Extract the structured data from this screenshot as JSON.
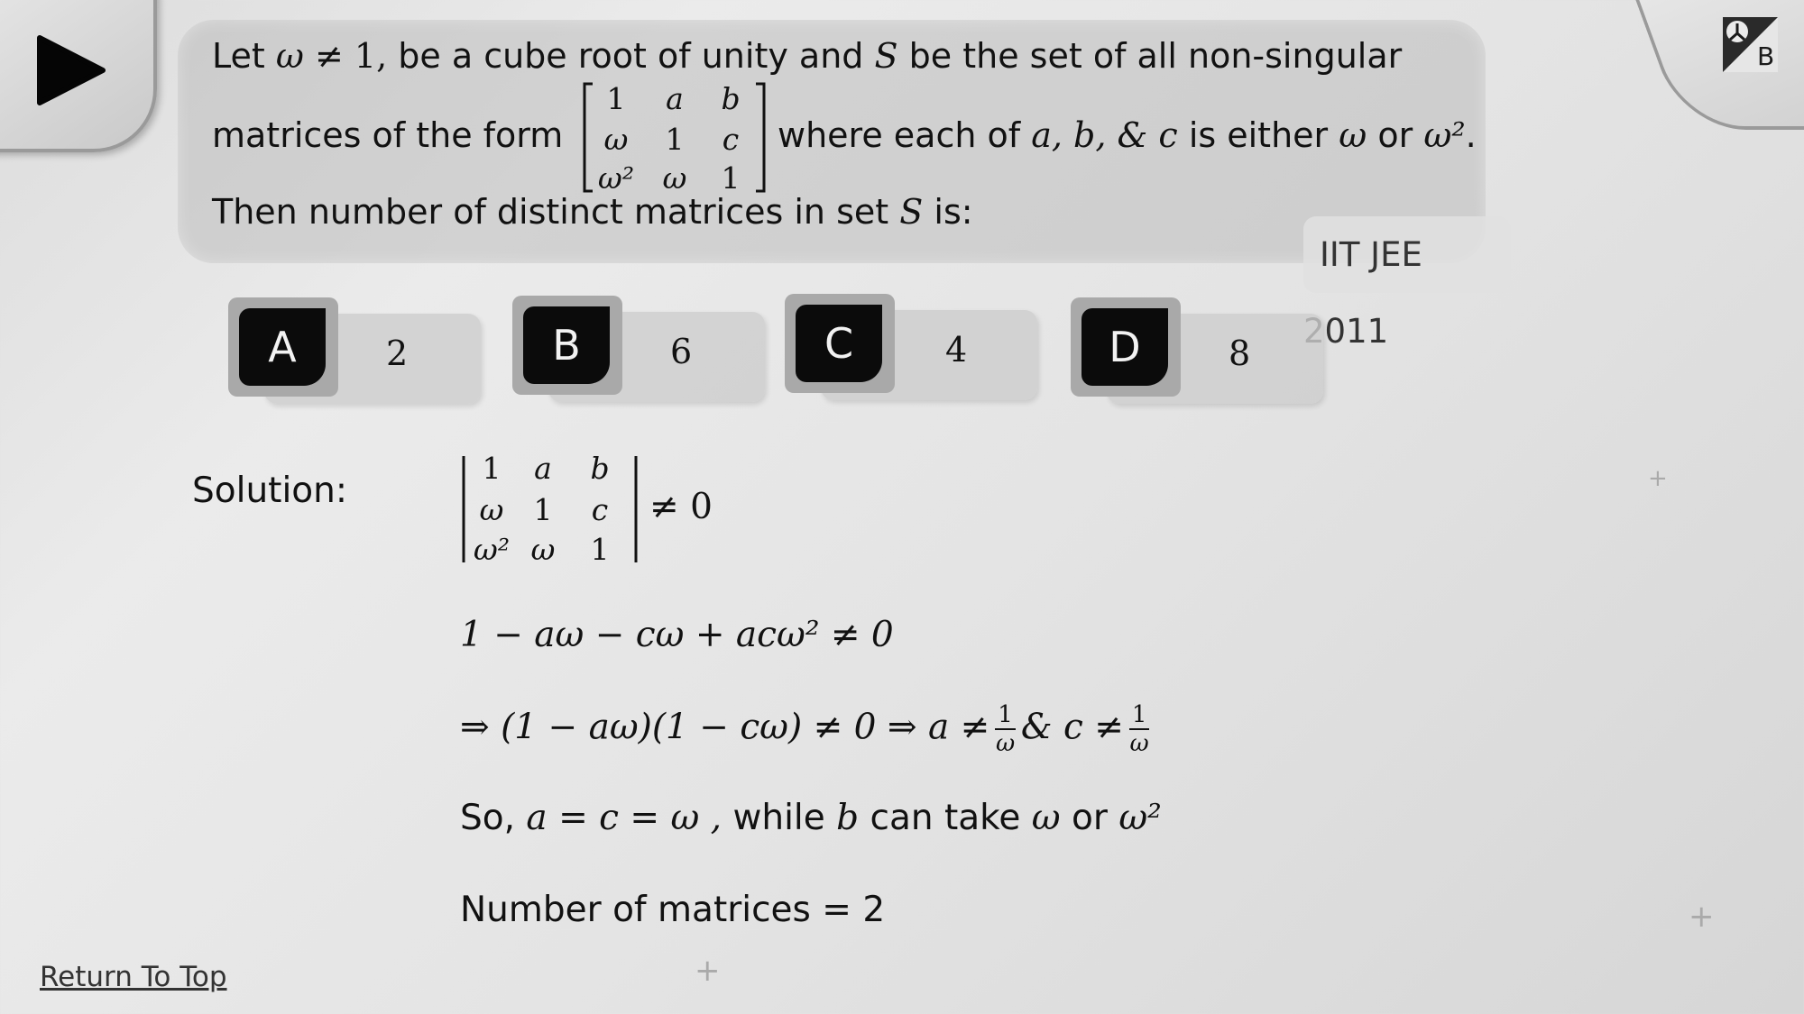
{
  "question": {
    "line1_a": "Let",
    "line1_omega": "ω",
    "line1_neq": "≠ 1,",
    "line1_b": "be a cube root of unity and",
    "line1_S": "S",
    "line1_c": "be the set of all non-singular",
    "line2_a": "matrices of the form",
    "line2_b": "where each of",
    "line2_vars": "a, b, & c",
    "line2_c": "is either",
    "line2_w": "ω",
    "line2_or": "or",
    "line2_w2": "ω²",
    "line2_period": ".",
    "line3_a": "Then number of distinct matrices in set",
    "line3_S": "S",
    "line3_b": "is:",
    "matrix": [
      "1",
      "a",
      "b",
      "ω",
      "1",
      "c",
      "ω²",
      "ω",
      "1"
    ]
  },
  "tag": "IIT JEE 2011",
  "options": [
    {
      "key": "A",
      "value": "2"
    },
    {
      "key": "B",
      "value": "6"
    },
    {
      "key": "C",
      "value": "4"
    },
    {
      "key": "D",
      "value": "8"
    }
  ],
  "solution": {
    "label": "Solution:",
    "det_matrix": [
      "1",
      "a",
      "b",
      "ω",
      "1",
      "c",
      "ω²",
      "ω",
      "1"
    ],
    "det_neq": "≠ 0",
    "step1": "1 − aω − cω + acω² ≠ 0",
    "step2_a": "⇒ (1 − aω)(1 − cω) ≠ 0  ⇒ a ≠",
    "step2_amp": "& c ≠",
    "frac_num": "1",
    "frac_den": "ω",
    "step3_a": "So,",
    "step3_eq": "a = c = ω ,",
    "step3_b": "while",
    "step3_var": "b",
    "step3_c": "can take",
    "step3_w": "ω",
    "step3_or": "or",
    "step3_w2": "ω²",
    "step4": "Number of matrices = 2"
  },
  "footer": {
    "return_top": "Return To Top"
  },
  "icons": [
    "play-icon",
    "logo-icon",
    "plus-icon"
  ],
  "colors": {
    "key_bg": "#0b0b0b",
    "key_text": "#f2f2f2",
    "background": "#e4e4e4"
  }
}
